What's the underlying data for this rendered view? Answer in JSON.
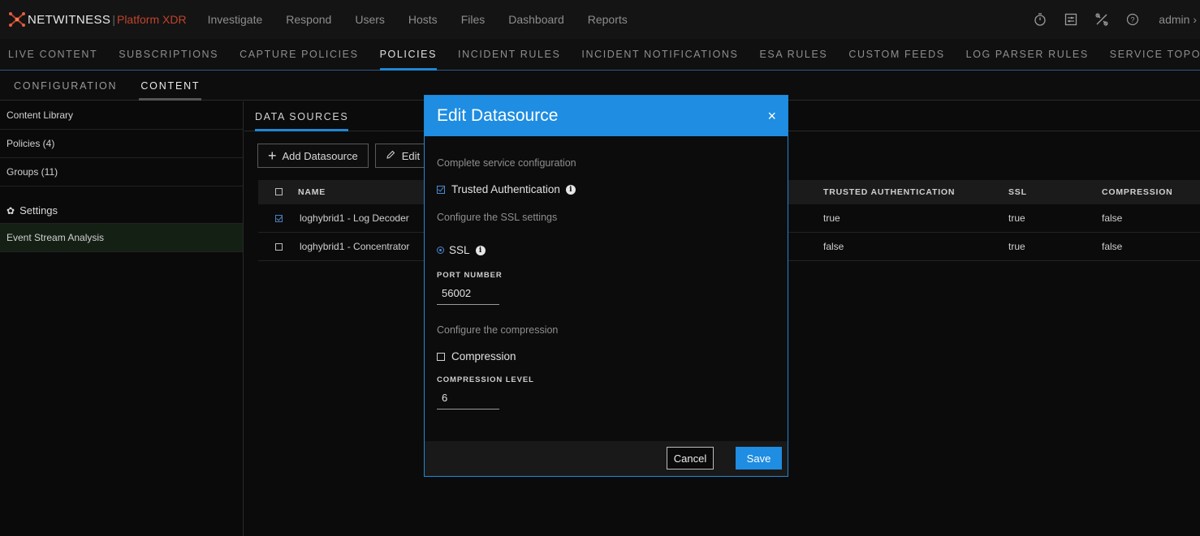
{
  "topbar": {
    "brand": "NETWITNESS",
    "separator": "|",
    "product": "Platform XDR",
    "nav": [
      "Investigate",
      "Respond",
      "Users",
      "Hosts",
      "Files",
      "Dashboard",
      "Reports"
    ],
    "user": "admin",
    "user_chevron": "›",
    "icons": [
      "timer-icon",
      "settings-panel-icon",
      "tools-icon",
      "help-icon"
    ]
  },
  "subnav": {
    "items": [
      "LIVE CONTENT",
      "SUBSCRIPTIONS",
      "CAPTURE POLICIES",
      "POLICIES",
      "INCIDENT RULES",
      "INCIDENT NOTIFICATIONS",
      "ESA RULES",
      "CUSTOM FEEDS",
      "LOG PARSER RULES",
      "SERVICE TOPOLOGY"
    ],
    "active": "POLICIES"
  },
  "tertnav": {
    "items": [
      "CONFIGURATION",
      "CONTENT"
    ],
    "active": "CONTENT"
  },
  "sidebar": {
    "items": [
      "Content Library",
      "Policies (4)",
      "Groups (11)"
    ],
    "settings_label": "Settings",
    "settings_items": [
      "Event Stream Analysis"
    ]
  },
  "main": {
    "tab": "DATA SOURCES",
    "add_button": "Add Datasource",
    "edit_button": "Edit",
    "columns": {
      "name": "NAME",
      "trusted": "TRUSTED AUTHENTICATION",
      "ssl": "SSL",
      "compression": "COMPRESSION"
    },
    "rows": [
      {
        "checked": true,
        "name": "loghybrid1 - Log Decoder",
        "trusted": "true",
        "ssl": "true",
        "compression": "false"
      },
      {
        "checked": false,
        "name": "loghybrid1 - Concentrator",
        "trusted": "false",
        "ssl": "true",
        "compression": "false"
      }
    ]
  },
  "modal": {
    "title": "Edit Datasource",
    "close": "×",
    "service_heading": "Complete service configuration",
    "trusted_label": "Trusted Authentication",
    "trusted_checked": true,
    "ssl_heading": "Configure the SSL settings",
    "ssl_label": "SSL",
    "port_label": "PORT NUMBER",
    "port_value": "56002",
    "compression_heading": "Configure the compression",
    "compression_label": "Compression",
    "compression_checked": false,
    "compression_level_label": "COMPRESSION LEVEL",
    "compression_level_value": "6",
    "cancel": "Cancel",
    "save": "Save"
  },
  "colors": {
    "accent": "#1e8de2",
    "brand_red": "#c0442a"
  }
}
